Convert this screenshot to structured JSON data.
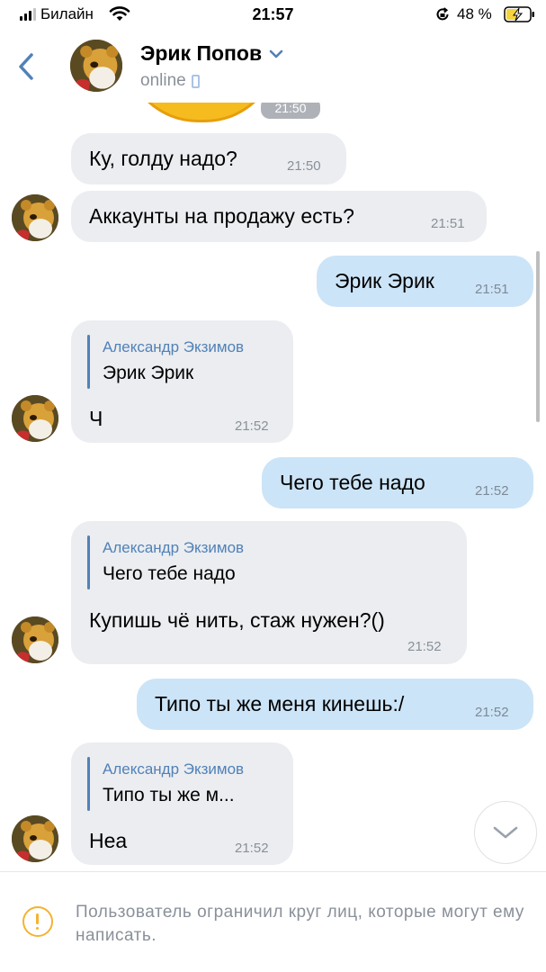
{
  "status_bar": {
    "carrier": "Билайн",
    "time": "21:57",
    "battery_percent": "48 %"
  },
  "header": {
    "contact_name": "Эрик Попов",
    "status": "online"
  },
  "sticker": {
    "time": "21:50"
  },
  "messages": [
    {
      "direction": "in",
      "text": "Ку, голду надо?",
      "time": "21:50"
    },
    {
      "direction": "in",
      "text": "Аккаунты на продажу есть?",
      "time": "21:51"
    },
    {
      "direction": "out",
      "text": "Эрик Эрик",
      "time": "21:51"
    },
    {
      "direction": "in",
      "reply_author": "Александр Экзимов",
      "reply_text": "Эрик Эрик",
      "text": "Ч",
      "time": "21:52"
    },
    {
      "direction": "out",
      "text": "Чего тебе надо",
      "time": "21:52"
    },
    {
      "direction": "in",
      "reply_author": "Александр Экзимов",
      "reply_text": "Чего тебе надо",
      "text": "Купишь чё нить, стаж нужен?()",
      "time": "21:52"
    },
    {
      "direction": "out",
      "text": "Типо ты же меня кинешь:/",
      "time": "21:52"
    },
    {
      "direction": "in",
      "reply_author": "Александр Экзимов",
      "reply_text": "Типо ты же м...",
      "text": "Неа",
      "time": "21:52"
    }
  ],
  "footer": {
    "restriction_notice": "Пользователь ограничил круг лиц, которые могут ему написать."
  },
  "colors": {
    "accent": "#5181b8",
    "incoming_bubble": "#ebedf0",
    "outgoing_bubble": "#cce4f7",
    "warning": "#f5b330"
  },
  "icons": [
    "signal-icon",
    "wifi-icon",
    "rotation-lock-icon",
    "battery-charging-icon",
    "back-chevron-icon",
    "chevron-down-icon",
    "phone-icon",
    "warning-icon",
    "scroll-down-icon"
  ]
}
